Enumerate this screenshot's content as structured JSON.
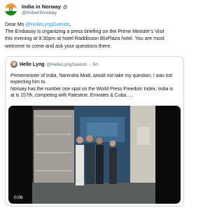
{
  "author": {
    "display_name": "India in Norway",
    "handle": "@IndiainNorway",
    "verified_icon": "verified-badge-icon",
    "avatar": "india-flag-avatar"
  },
  "tweet": {
    "greeting_prefix": "Dear Ms ",
    "greeting_mention": "@HelleLyngSvends",
    "greeting_suffix": ",",
    "body_lines": [
      "The Embassy is organizing a press briefing on the Prime Minister's Visit",
      "this evening at 9:30pm at hotel Raddisson BluPlaza hotel. You are most",
      "welcome to come and ask your questions there."
    ]
  },
  "quoted_tweet": {
    "author_name": "Helle Lyng",
    "handle": "@HelleLyngSvends",
    "separator": "·",
    "time": "5h",
    "paragraph1_lines": [
      "Primeminister of India, Narendra Modi, would not take my question, I was not",
      "expecting him to."
    ],
    "paragraph2_lines": [
      "Norway has the number one spot on the World Press Freedom Index, India is",
      "at is 157th, competing with Palestine, Emirates & Cuba. ..."
    ],
    "video": {
      "timestamp": "0:06"
    }
  },
  "colors": {
    "link": "#1d9bf0",
    "secondary_text": "#536471",
    "border": "#cfd9de",
    "flag_saffron": "#ff9933",
    "flag_green": "#138808",
    "flag_chakra": "#0b3d91"
  }
}
